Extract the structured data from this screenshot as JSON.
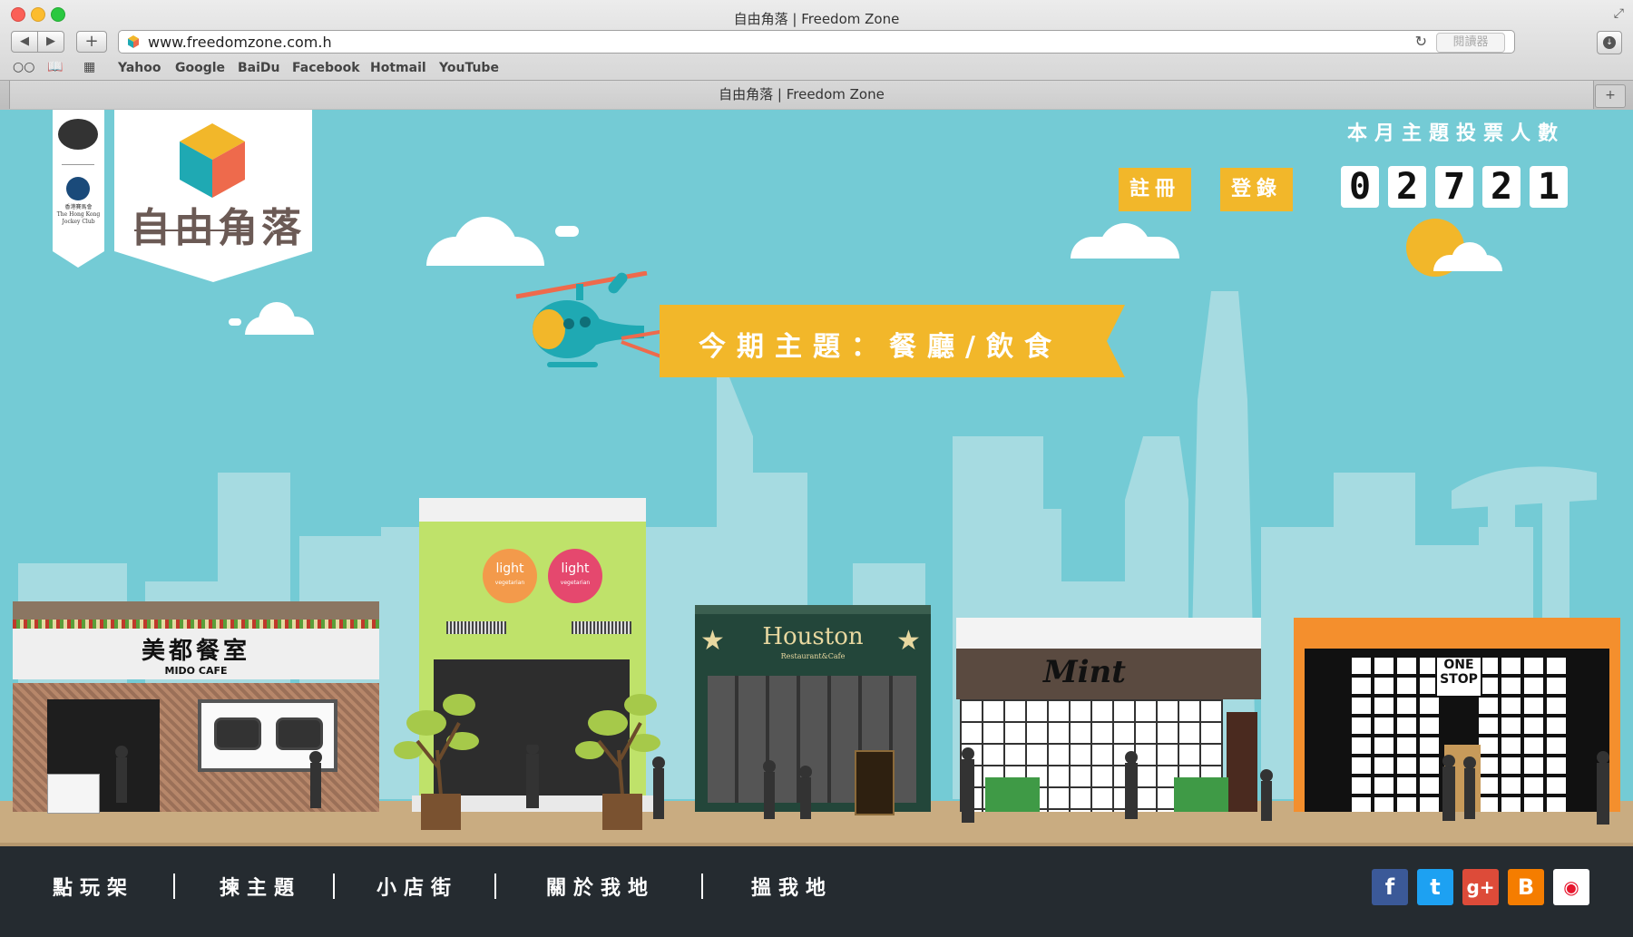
{
  "browser": {
    "window_title": "自由角落 | Freedom Zone",
    "url": "www.freedomzone.com.h",
    "reader_label": "閱讀器",
    "bookmarks": [
      "Yahoo",
      "Google",
      "BaiDu",
      "Facebook",
      "Hotmail",
      "YouTube"
    ],
    "tab_title": "自由角落 | Freedom Zone"
  },
  "site": {
    "logo_text": "自由角落",
    "sponsor_text": "香港賽馬會\nThe Hong Kong\nJockey Club",
    "register_label": "註冊",
    "login_label": "登錄",
    "vote_label": "本月主題投票人數",
    "vote_count": [
      "0",
      "2",
      "7",
      "2",
      "1"
    ],
    "theme_title": "今期主題：餐廳/飲食"
  },
  "shops": {
    "mido": {
      "chinese": "美都餐室",
      "english": "MIDO CAFE"
    },
    "light": {
      "sign1": "light",
      "sign1_sub": "vegetarian",
      "sign2": "light",
      "sign2_sub": "vegetarian"
    },
    "houston": {
      "name": "Houston",
      "sub": "Restaurant&Cafe"
    },
    "mint": {
      "name": "Mint"
    },
    "onestop": {
      "line1": "ONE",
      "line2": "STOP"
    }
  },
  "footer": {
    "links": [
      "點玩架",
      "揀主題",
      "小店街",
      "關於我地",
      "搵我地"
    ],
    "social": [
      "facebook",
      "twitter",
      "google-plus",
      "blogger",
      "weibo"
    ]
  },
  "colors": {
    "sky": "#74cbd5",
    "accent_yellow": "#f2b72a",
    "footer_bg": "#252b30",
    "ground": "#c9ac81"
  }
}
